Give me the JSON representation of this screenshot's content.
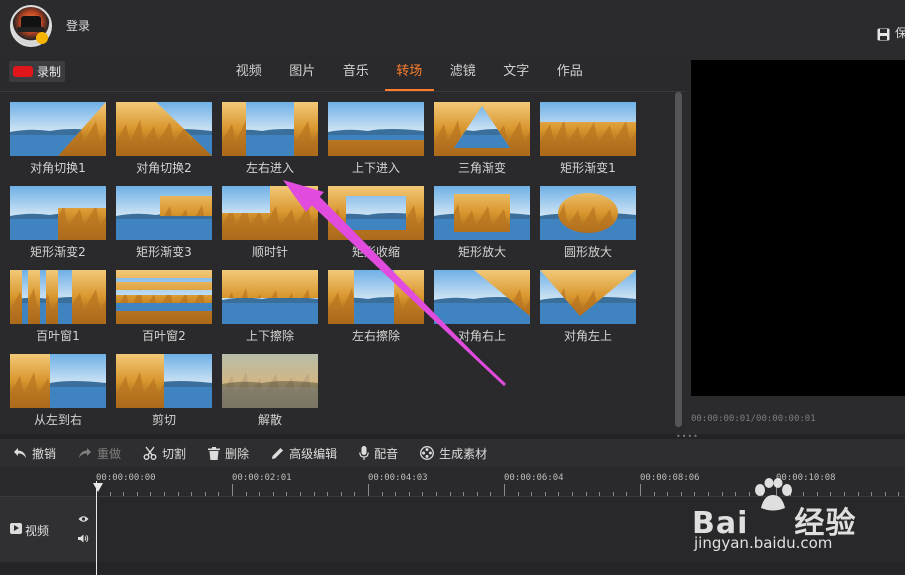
{
  "header": {
    "login_label": "登录",
    "save_label": "保"
  },
  "record": {
    "label": "录制",
    "color": "#e0161b"
  },
  "tabs": [
    {
      "label": "视频",
      "active": false
    },
    {
      "label": "图片",
      "active": false
    },
    {
      "label": "音乐",
      "active": false
    },
    {
      "label": "转场",
      "active": true
    },
    {
      "label": "滤镜",
      "active": false
    },
    {
      "label": "文字",
      "active": false
    },
    {
      "label": "作品",
      "active": false
    }
  ],
  "accent_color": "#ff7d2a",
  "transitions": [
    {
      "label": "对角切换1",
      "effect": "diag-split"
    },
    {
      "label": "对角切换2",
      "effect": "diag-split2"
    },
    {
      "label": "左右进入",
      "effect": "lr-enter"
    },
    {
      "label": "上下进入",
      "effect": "tb-enter"
    },
    {
      "label": "三角渐变",
      "effect": "triangle"
    },
    {
      "label": "矩形渐变1",
      "effect": "rect-fade1"
    },
    {
      "label": "矩形渐变2",
      "effect": "rect-fade2"
    },
    {
      "label": "矩形渐变3",
      "effect": "rect-fade3"
    },
    {
      "label": "顺时针",
      "effect": "clockwise"
    },
    {
      "label": "矩形收缩",
      "effect": "rect-shrink"
    },
    {
      "label": "矩形放大",
      "effect": "rect-grow"
    },
    {
      "label": "圆形放大",
      "effect": "circle-grow"
    },
    {
      "label": "百叶窗1",
      "effect": "blinds1"
    },
    {
      "label": "百叶窗2",
      "effect": "blinds2"
    },
    {
      "label": "上下擦除",
      "effect": "tb-wipe"
    },
    {
      "label": "左右擦除",
      "effect": "lr-wipe"
    },
    {
      "label": "对角右上",
      "effect": "diag-tr"
    },
    {
      "label": "对角左上",
      "effect": "diag-tl"
    },
    {
      "label": "从左到右",
      "effect": "left-right"
    },
    {
      "label": "剪切",
      "effect": "cut"
    },
    {
      "label": "解散",
      "effect": "dissolve"
    }
  ],
  "preview": {
    "time": "00:00:00:01/00:00:00:01"
  },
  "toolbar": {
    "undo": "撤销",
    "redo": "重做",
    "cut": "切割",
    "delete": "删除",
    "advanced": "高级编辑",
    "dub": "配音",
    "generate": "生成素材"
  },
  "ruler": {
    "labels": [
      "00:00:00:00",
      "00:00:02:01",
      "00:00:04:03",
      "00:00:06:04",
      "00:00:08:06",
      "00:00:10:08"
    ]
  },
  "track": {
    "name": "视频"
  },
  "watermark": {
    "brand": "Bai",
    "brand2": "经验",
    "url": "jingyan.baidu.com"
  }
}
